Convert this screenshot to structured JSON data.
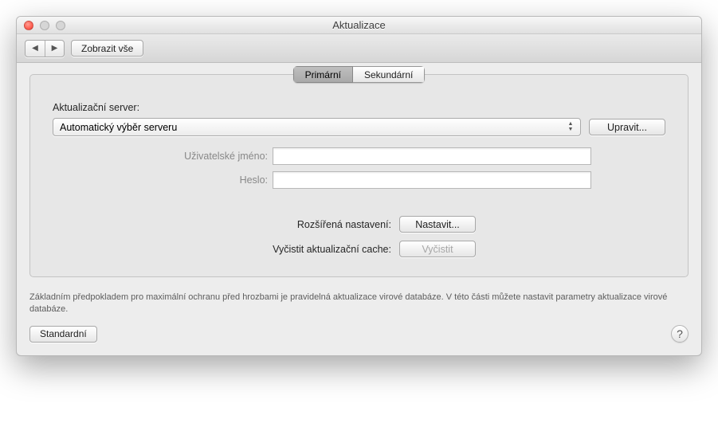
{
  "window": {
    "title": "Aktualizace"
  },
  "toolbar": {
    "show_all": "Zobrazit vše"
  },
  "tabs": {
    "primary": "Primární",
    "secondary": "Sekundární"
  },
  "server": {
    "label": "Aktualizační server:",
    "selected": "Automatický výběr serveru",
    "edit": "Upravit..."
  },
  "credentials": {
    "user_label": "Uživatelské jméno:",
    "user_value": "",
    "pass_label": "Heslo:",
    "pass_value": ""
  },
  "advanced": {
    "settings_label": "Rozšířená nastavení:",
    "settings_button": "Nastavit...",
    "clear_label": "Vyčistit aktualizační cache:",
    "clear_button": "Vyčistit"
  },
  "help": "Základním předpokladem pro maximální ochranu před hrozbami je pravidelná aktualizace virové databáze. V této části můžete nastavit parametry aktualizace virové databáze.",
  "footer": {
    "defaults": "Standardní"
  }
}
